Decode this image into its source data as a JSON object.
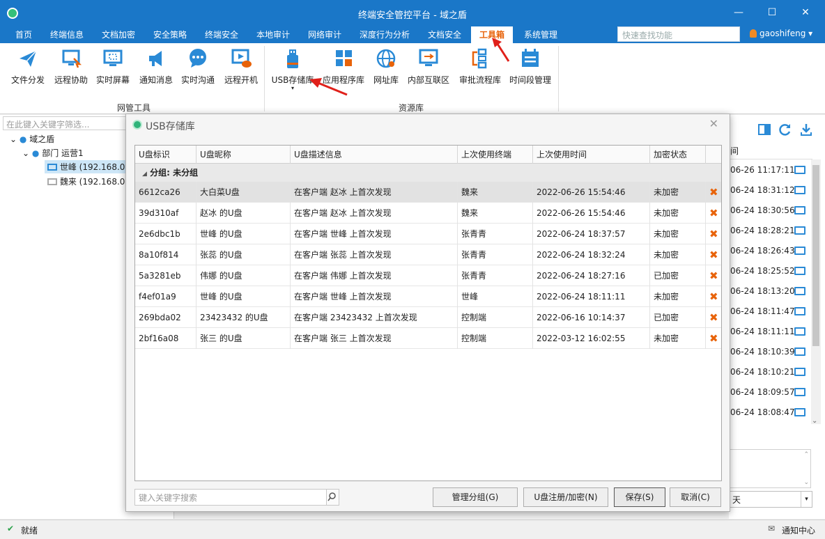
{
  "window": {
    "title": "终端安全管控平台 - 域之盾"
  },
  "menu": {
    "items": [
      "首页",
      "终端信息",
      "文档加密",
      "安全策略",
      "终端安全",
      "本地审计",
      "网络审计",
      "深度行为分析",
      "文档安全",
      "工具箱",
      "系统管理"
    ],
    "active": "工具箱",
    "quick_search_placeholder": "快速查找功能",
    "user": "gaoshifeng"
  },
  "ribbon": {
    "groups": [
      {
        "label": "网管工具",
        "buttons": [
          "文件分发",
          "远程协助",
          "实时屏幕",
          "通知消息",
          "实时沟通",
          "远程开机"
        ]
      },
      {
        "label": "资源库",
        "buttons": [
          "USB存储库",
          "应用程序库",
          "网址库",
          "内部互联区",
          "审批流程库",
          "时间段管理"
        ]
      }
    ]
  },
  "colors": {
    "accent": "#1a77c8",
    "active_menu": "#e8630a",
    "delete": "#e8630a",
    "icon_blue": "#2a8ad6"
  },
  "left": {
    "filter_placeholder": "在此键入关键字筛选...",
    "tree": {
      "root": "域之盾",
      "dept": "部门 运营1",
      "n1": "世峰 (192.168.0.",
      "n2": "魏来 (192.168.0."
    }
  },
  "right": {
    "header": "间",
    "times": [
      "06-26 11:17:11",
      "06-24 18:31:12",
      "06-24 18:30:56",
      "06-24 18:28:21",
      "06-24 18:26:43",
      "06-24 18:25:52",
      "06-24 18:13:20",
      "06-24 18:11:47",
      "06-24 18:11:11",
      "06-24 18:10:39",
      "06-24 18:10:21",
      "06-24 18:09:57",
      "06-24 18:08:47"
    ],
    "combo": "天"
  },
  "dialog": {
    "title": "USB存储库",
    "columns": [
      "U盘标识",
      "U盘昵称",
      "U盘描述信息",
      "上次使用终端",
      "上次使用时间",
      "加密状态"
    ],
    "group": "分组: 未分组",
    "rows": [
      {
        "id": "6612ca26",
        "name": "大白菜U盘",
        "desc": "在客户端 赵冰 上首次发现",
        "terminal": "魏来",
        "time": "2022-06-26 15:54:46",
        "status": "未加密"
      },
      {
        "id": "39d310af",
        "name": "赵冰 的U盘",
        "desc": "在客户端 赵冰 上首次发现",
        "terminal": "魏来",
        "time": "2022-06-26 15:54:46",
        "status": "未加密"
      },
      {
        "id": "2e6dbc1b",
        "name": "世峰 的U盘",
        "desc": "在客户端 世峰 上首次发现",
        "terminal": "张青青",
        "time": "2022-06-24 18:37:57",
        "status": "未加密"
      },
      {
        "id": "8a10f814",
        "name": "张蕊 的U盘",
        "desc": "在客户端 张蕊 上首次发现",
        "terminal": "张青青",
        "time": "2022-06-24 18:32:24",
        "status": "未加密"
      },
      {
        "id": "5a3281eb",
        "name": "伟娜 的U盘",
        "desc": "在客户端 伟娜 上首次发现",
        "terminal": "张青青",
        "time": "2022-06-24 18:27:16",
        "status": "已加密"
      },
      {
        "id": "f4ef01a9",
        "name": "世峰 的U盘",
        "desc": "在客户端 世峰 上首次发现",
        "terminal": "世峰",
        "time": "2022-06-24 18:11:11",
        "status": "未加密"
      },
      {
        "id": "269bda02",
        "name": "23423432 的U盘",
        "desc": "在客户端 23423432 上首次发现",
        "terminal": "控制端",
        "time": "2022-06-16 10:14:37",
        "status": "已加密"
      },
      {
        "id": "2bf16a08",
        "name": "张三 的U盘",
        "desc": "在客户端 张三 上首次发现",
        "terminal": "控制端",
        "time": "2022-03-12 16:02:55",
        "status": "未加密"
      }
    ],
    "search_placeholder": "键入关键字搜索",
    "buttons": {
      "manage": "管理分组(G)",
      "register": "U盘注册/加密(N)",
      "save": "保存(S)",
      "cancel": "取消(C)"
    }
  },
  "status": {
    "ready": "就绪",
    "notify": "通知中心"
  }
}
